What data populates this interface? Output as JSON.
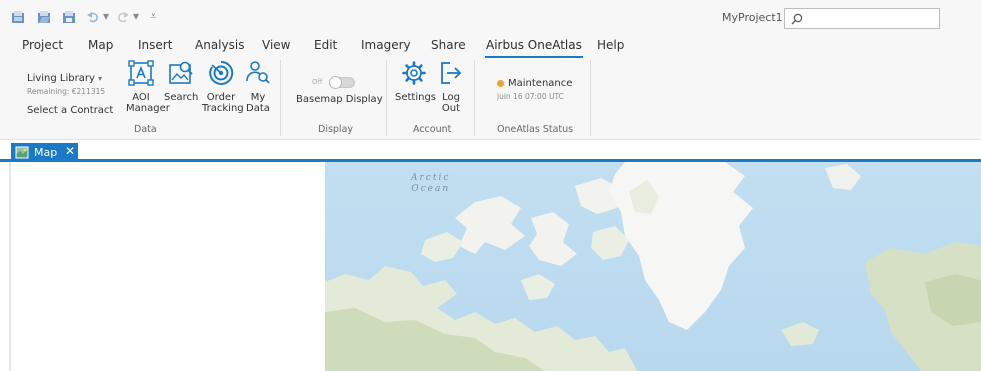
{
  "titlebar": {
    "project_name": "MyProject1",
    "search": {
      "value": "",
      "placeholder": ""
    }
  },
  "tabs": [
    {
      "label": "Project"
    },
    {
      "label": "Map"
    },
    {
      "label": "Insert"
    },
    {
      "label": "Analysis"
    },
    {
      "label": "View"
    },
    {
      "label": "Edit"
    },
    {
      "label": "Imagery"
    },
    {
      "label": "Share"
    },
    {
      "label": "Airbus OneAtlas",
      "active": true
    },
    {
      "label": "Help"
    }
  ],
  "ribbon": {
    "data_group": {
      "label": "Data",
      "living_library": "Living Library",
      "remaining": "Remaining: €211315",
      "select_contract": "Select a Contract",
      "aoi_line1": "AOI",
      "aoi_line2": "Manager",
      "search": "Search",
      "order_line1": "Order",
      "order_line2": "Tracking",
      "mydata_line1": "My",
      "mydata_line2": "Data"
    },
    "display_group": {
      "label": "Display",
      "toggle_state": "Off",
      "basemap_display": "Basemap Display"
    },
    "account_group": {
      "label": "Account",
      "settings": "Settings",
      "logout_line1": "Log",
      "logout_line2": "Out"
    },
    "status_group": {
      "label": "OneAtlas Status",
      "status": "Maintenance",
      "status_time": "juin 16 07:00 UTC",
      "status_color": "#f0a32e"
    }
  },
  "document": {
    "tab_label": "Map",
    "accent_color": "#1b79c6"
  },
  "map": {
    "ocean_line1": "Arctic",
    "ocean_line2": "Ocean"
  }
}
